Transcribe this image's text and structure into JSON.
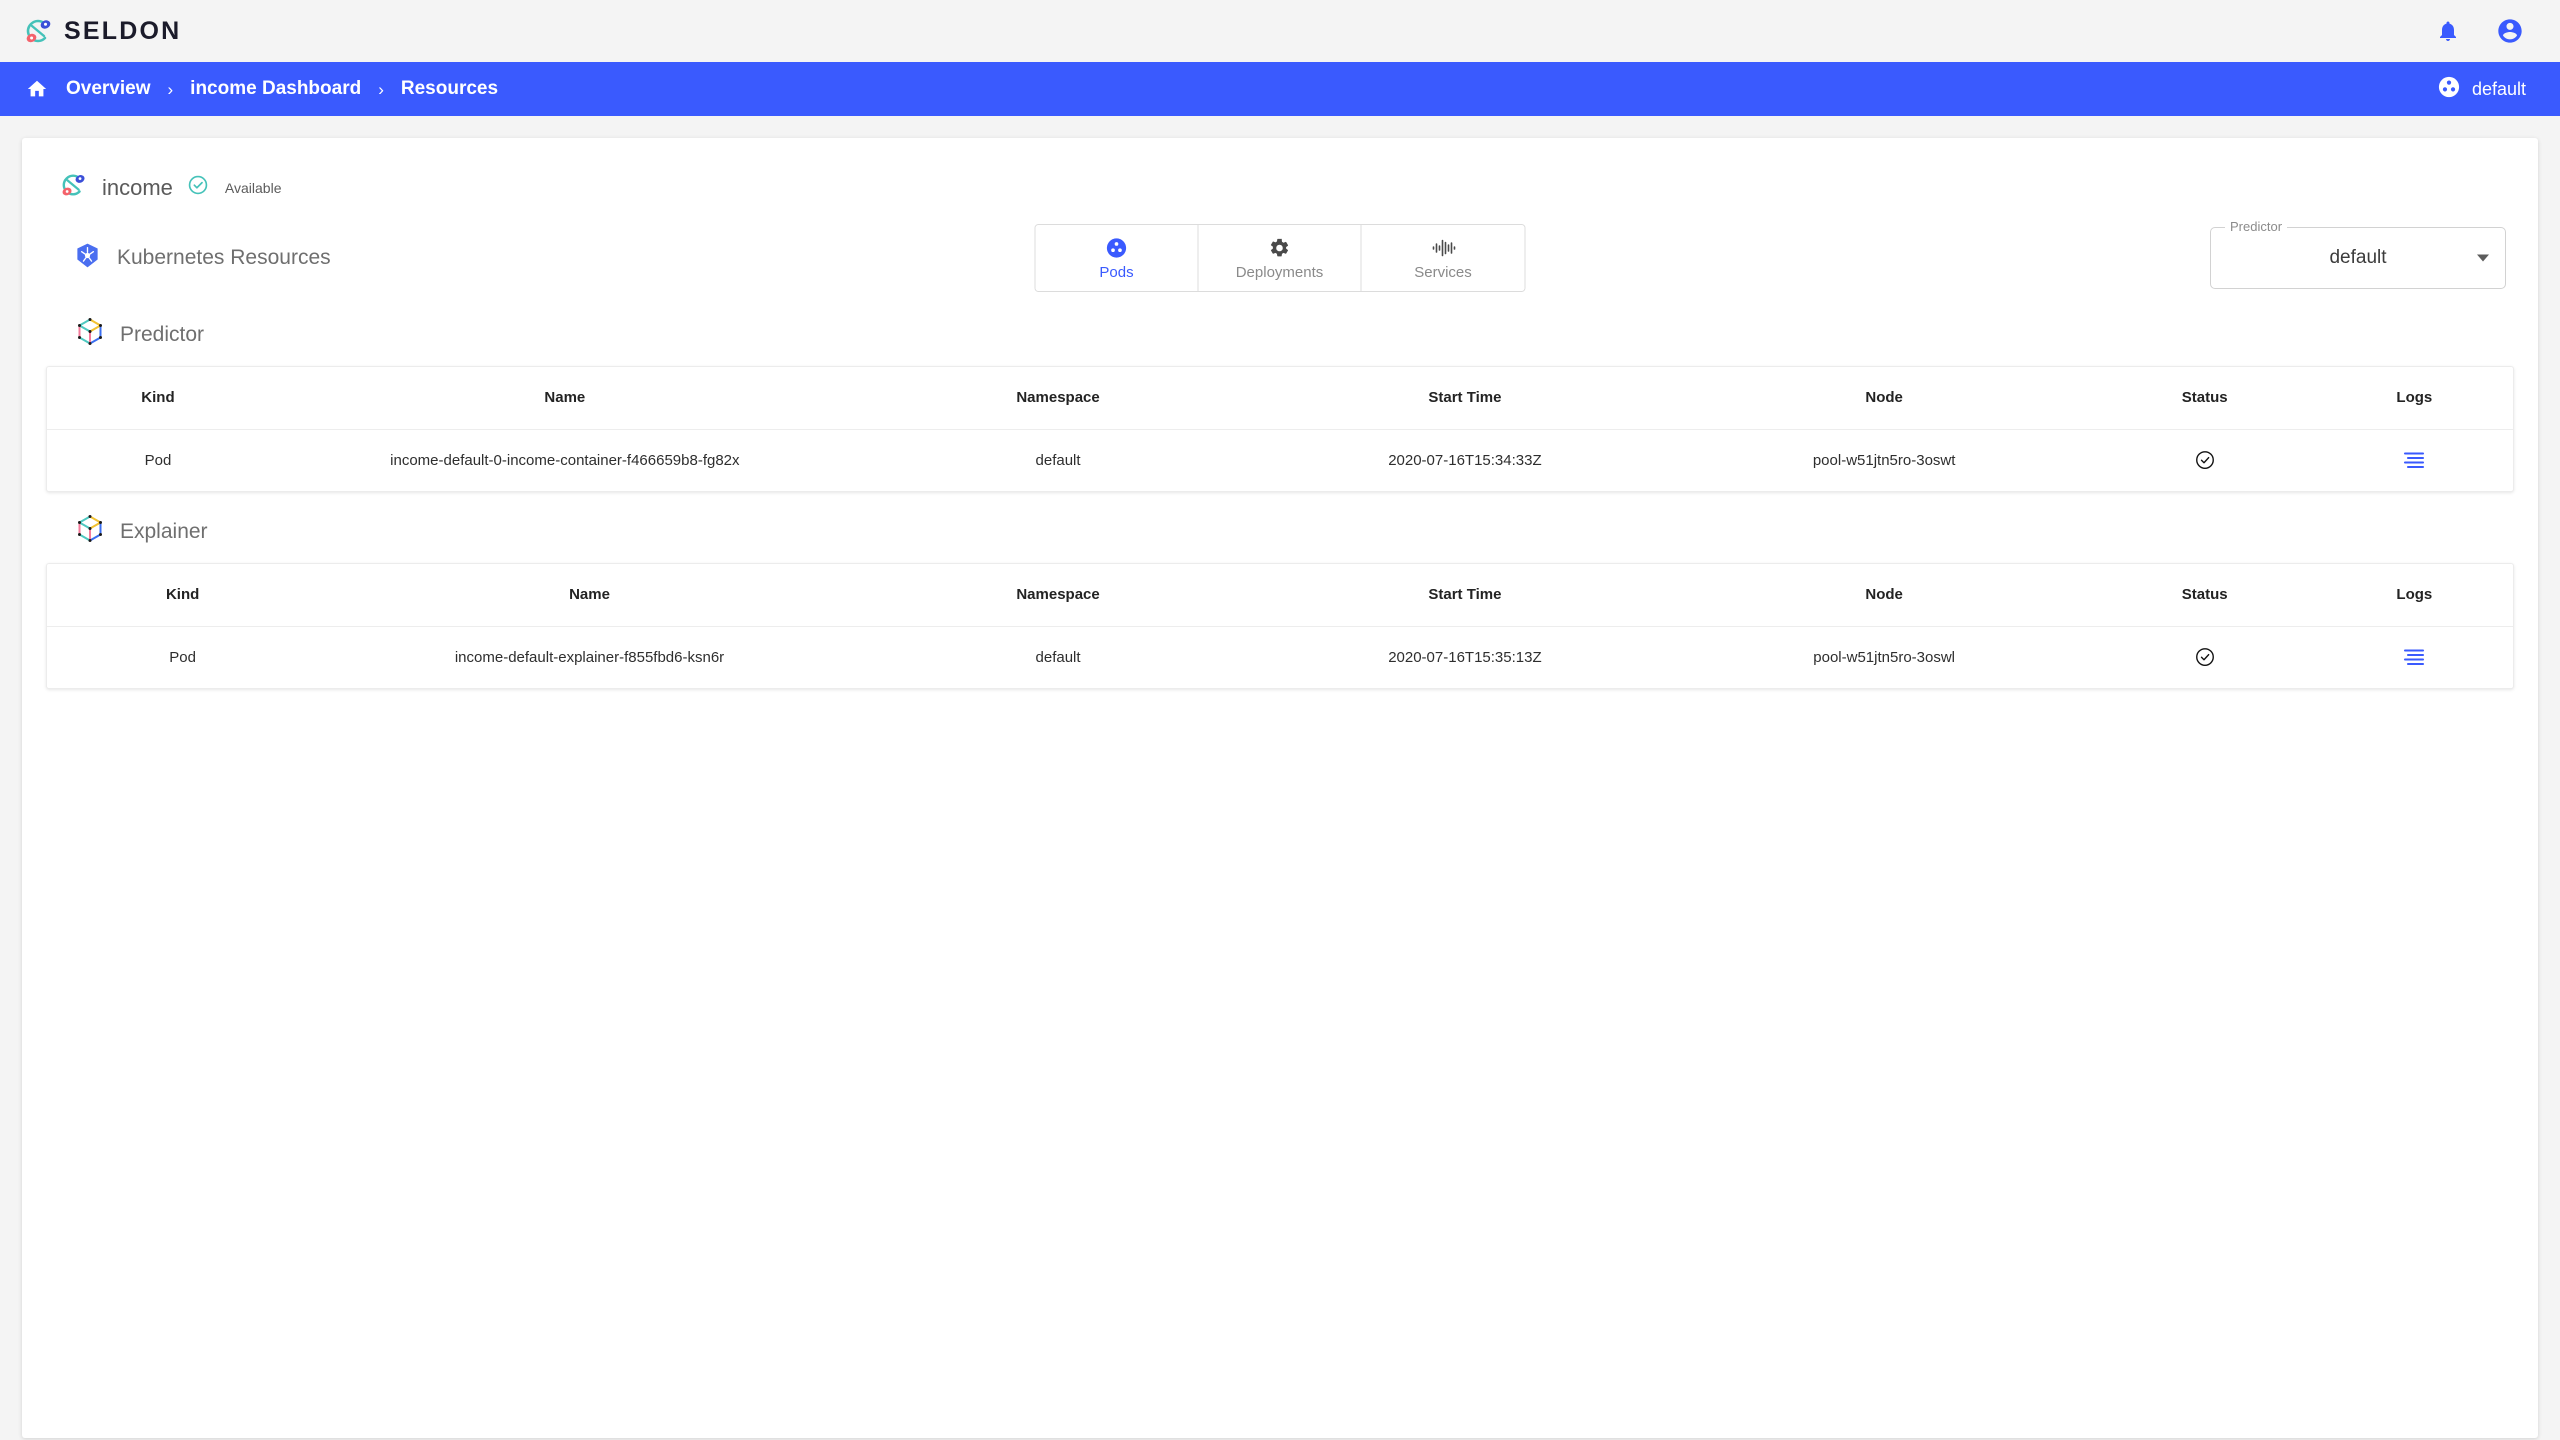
{
  "header": {
    "brand_word": "SELDON",
    "brand_logo_icon": "seldon-logo-icon",
    "notifications_icon": "bell-icon",
    "account_icon": "account-circle-icon"
  },
  "breadcrumb": {
    "home_icon": "home-icon",
    "separator": "›",
    "items": [
      {
        "label": "Overview"
      },
      {
        "label": "income Dashboard"
      },
      {
        "label": "Resources"
      }
    ],
    "namespace": {
      "icon": "kubernetes-icon",
      "label": "default"
    },
    "bar_color": "#3a5afe"
  },
  "model": {
    "icon": "seldon-deployment-icon",
    "name": "income",
    "status_icon": "check-circle-icon",
    "status_color": "#45c2b9",
    "status_label": "Available"
  },
  "resources": {
    "icon": "kubernetes-icon",
    "title": "Kubernetes Resources",
    "tabs": [
      {
        "label": "Pods",
        "icon": "kubernetes-pod-icon",
        "selected": true
      },
      {
        "label": "Deployments",
        "icon": "gear-icon",
        "selected": false
      },
      {
        "label": "Services",
        "icon": "waveform-icon",
        "selected": false
      }
    ],
    "predictor_select": {
      "label": "Predictor",
      "value": "default",
      "options": [
        "default"
      ],
      "arrow_icon": "chevron-down-icon"
    }
  },
  "sections": [
    {
      "icon": "cube-icon",
      "title": "Predictor",
      "columns": [
        "Kind",
        "Name",
        "Namespace",
        "Start Time",
        "Node",
        "Status",
        "Logs"
      ],
      "rows": [
        {
          "kind": "Pod",
          "name": "income-default-0-income-container-f466659b8-fg82x",
          "namespace": "default",
          "start_time": "2020-07-16T15:34:33Z",
          "node": "pool-w51jtn5ro-3oswt",
          "status_icon": "check-circle-outline-icon",
          "logs_icon": "logs-lines-icon"
        }
      ]
    },
    {
      "icon": "cube-icon",
      "title": "Explainer",
      "columns": [
        "Kind",
        "Name",
        "Namespace",
        "Start Time",
        "Node",
        "Status",
        "Logs"
      ],
      "rows": [
        {
          "kind": "Pod",
          "name": "income-default-explainer-f855fbd6-ksn6r",
          "namespace": "default",
          "start_time": "2020-07-16T15:35:13Z",
          "node": "pool-w51jtn5ro-3oswl",
          "status_icon": "check-circle-outline-icon",
          "logs_icon": "logs-lines-icon"
        }
      ]
    }
  ],
  "colors": {
    "accent_blue": "#3a5afe",
    "teal": "#45c2b9",
    "logo_red": "#f4626b",
    "logo_blue": "#3b4fd8"
  }
}
